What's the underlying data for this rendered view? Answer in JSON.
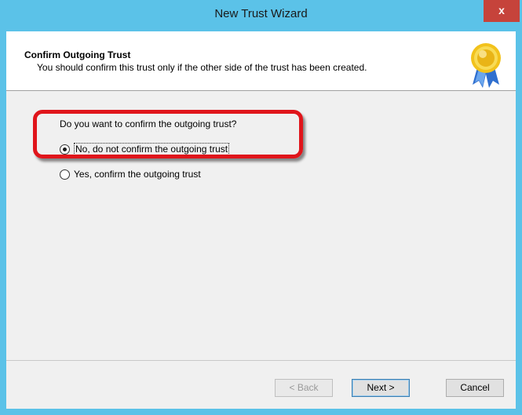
{
  "window": {
    "title": "New Trust Wizard",
    "close_label": "x"
  },
  "header": {
    "title": "Confirm Outgoing Trust",
    "subtitle": "You should confirm this trust only if the other side of the trust has been created.",
    "icon": "award-ribbon-icon"
  },
  "form": {
    "question": "Do you want to confirm the outgoing trust?",
    "options": [
      {
        "label": "No, do not confirm the outgoing trust",
        "checked": true
      },
      {
        "label": "Yes, confirm the outgoing trust",
        "checked": false
      }
    ]
  },
  "buttons": {
    "back": "< Back",
    "next": "Next >",
    "cancel": "Cancel"
  },
  "colors": {
    "titlebar": "#5bc2e8",
    "close_button": "#c6433b",
    "highlight": "#e0151b"
  }
}
